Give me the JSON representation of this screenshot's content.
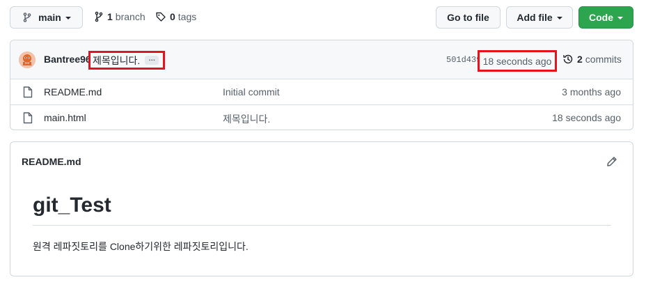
{
  "toolbar": {
    "branch_select": "main",
    "branch_count": "1",
    "branch_label": "branch",
    "tag_count": "0",
    "tag_label": "tags",
    "go_to_file": "Go to file",
    "add_file": "Add file",
    "code": "Code"
  },
  "latest_commit": {
    "author": "Bantree96",
    "message": "제목입니다.",
    "ellipsis": "…",
    "sha": "501d439",
    "time": "18 seconds ago",
    "commit_count": "2",
    "commits_label": "commits"
  },
  "files": [
    {
      "name": "README.md",
      "message": "Initial commit",
      "age": "3 months ago"
    },
    {
      "name": "main.html",
      "message": "제목입니다.",
      "age": "18 seconds ago"
    }
  ],
  "readme": {
    "filename": "README.md",
    "heading": "git_Test",
    "body": "원격 레파짓토리를 Clone하기위한 레파짓토리입니다."
  },
  "colors": {
    "code_button": "#2da44e",
    "highlight_box": "#e5131d"
  },
  "icons": [
    "branch-icon",
    "git-branch-icon",
    "tag-icon",
    "history-icon",
    "file-icon",
    "pencil-icon"
  ]
}
